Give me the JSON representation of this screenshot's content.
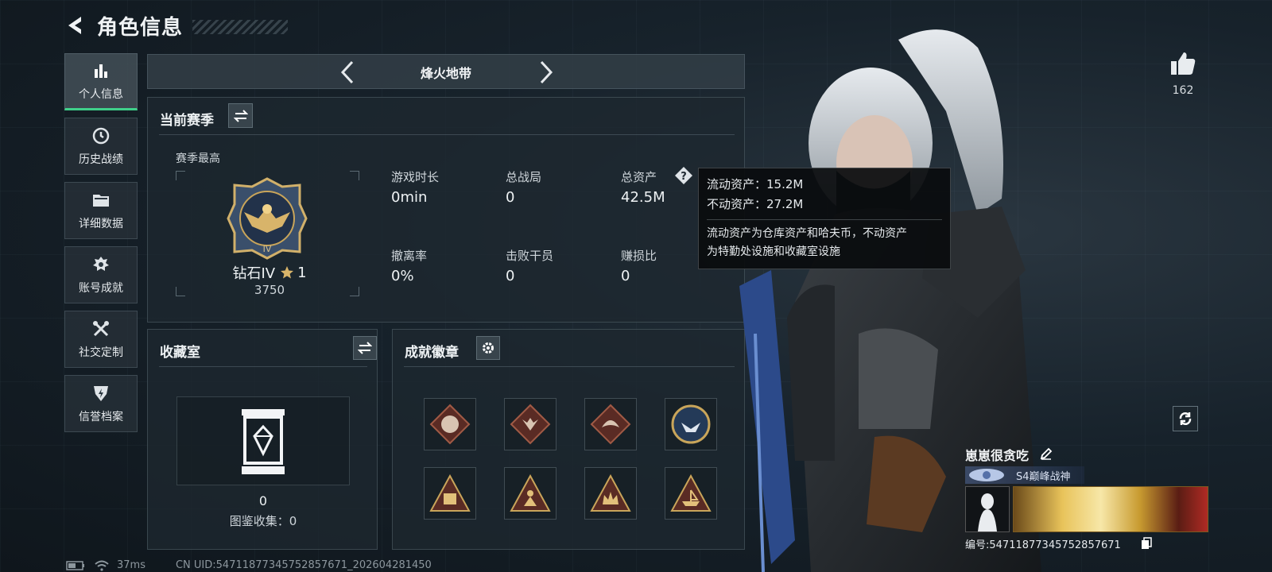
{
  "header": {
    "title": "角色信息"
  },
  "sidebar": {
    "items": [
      {
        "label": "个人信息",
        "icon": "bar-chart-icon",
        "active": true
      },
      {
        "label": "历史战绩",
        "icon": "history-clock-icon"
      },
      {
        "label": "详细数据",
        "icon": "folder-icon"
      },
      {
        "label": "账号成就",
        "icon": "achievement-icon"
      },
      {
        "label": "社交定制",
        "icon": "tools-icon"
      },
      {
        "label": "信誉档案",
        "icon": "shield-bolt-icon"
      }
    ]
  },
  "mode_selector": {
    "name": "烽火地带"
  },
  "season": {
    "title": "当前赛季",
    "best_label": "赛季最高",
    "rank_name": "钻石IV",
    "rank_stars": "1",
    "rank_points": "3750",
    "stats": [
      {
        "label": "游戏时长",
        "value": "0min"
      },
      {
        "label": "总战局",
        "value": "0"
      },
      {
        "label": "总资产",
        "value": "42.5M"
      },
      {
        "label": "撤离率",
        "value": "0%"
      },
      {
        "label": "击败干员",
        "value": "0"
      },
      {
        "label": "赚损比",
        "value": "0"
      }
    ]
  },
  "tooltip": {
    "liquid": "流动资产：15.2M",
    "fixed": "不动资产：27.2M",
    "desc_line1": "流动资产为仓库资产和哈夫币，不动资产",
    "desc_line2": "为特勤处设施和收藏室设施"
  },
  "collection": {
    "title": "收藏室",
    "count": "0",
    "collected": "图鉴收集：0"
  },
  "achievements": {
    "title": "成就徽章",
    "badges": [
      "ram-badge-icon",
      "wolf-badge-icon",
      "dragon-badge-icon",
      "eagle-badge-icon",
      "safe-badge-icon",
      "figure-badge-icon",
      "crown-badge-icon",
      "ship-badge-icon"
    ]
  },
  "profile": {
    "likes": "162",
    "player_name": "崽崽很贪吃",
    "title": "S4巅峰战神",
    "uid": "编号:54711877345752857671"
  },
  "status_bar": {
    "ping": "37ms",
    "uid_info": "CN UID:54711877345752857671_202604281450"
  },
  "colors": {
    "accent_green": "#3fd08a",
    "gold": "#c9a55a"
  }
}
